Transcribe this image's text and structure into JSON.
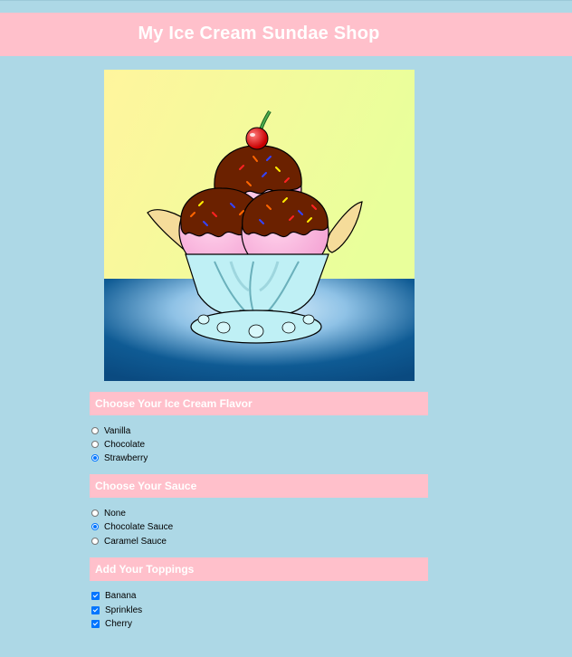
{
  "header": {
    "title": "My Ice Cream Sundae Shop"
  },
  "colors": {
    "background": "#add8e6",
    "header": "#ffc0cb",
    "accent": "#0075ff"
  },
  "sections": {
    "flavor": {
      "title": "Choose Your Ice Cream Flavor",
      "options": [
        "Vanilla",
        "Chocolate",
        "Strawberry"
      ],
      "selected": "Strawberry"
    },
    "sauce": {
      "title": "Choose Your Sauce",
      "options": [
        "None",
        "Chocolate Sauce",
        "Caramel Sauce"
      ],
      "selected": "Chocolate Sauce"
    },
    "toppings": {
      "title": "Add Your Toppings",
      "options": [
        "Banana",
        "Sprinkles",
        "Cherry"
      ],
      "checked": [
        true,
        true,
        true
      ]
    }
  }
}
